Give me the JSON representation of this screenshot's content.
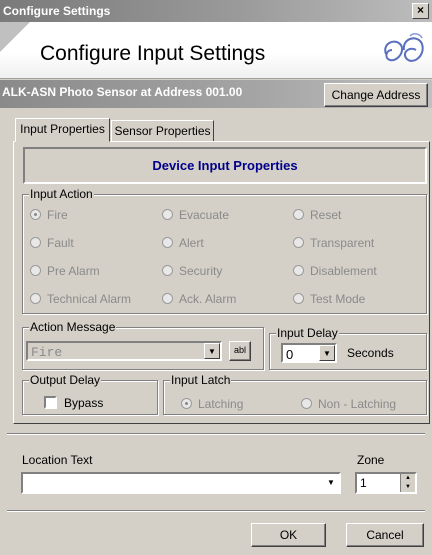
{
  "window": {
    "title": "Configure Settings",
    "close_glyph": "×"
  },
  "banner": {
    "heading": "Configure Input Settings",
    "logo_icon": "swirl-logo-icon"
  },
  "device": {
    "label": "ALK-ASN Photo Sensor at Address 001.00",
    "change_address_label": "Change Address"
  },
  "tabs": [
    {
      "label": "Input Properties",
      "selected": true
    },
    {
      "label": "Sensor Properties",
      "selected": false
    }
  ],
  "panel_title": "Device Input Properties",
  "input_action": {
    "legend": "Input Action",
    "options": [
      {
        "label": "Fire",
        "selected": true
      },
      {
        "label": "Evacuate",
        "selected": false
      },
      {
        "label": "Reset",
        "selected": false
      },
      {
        "label": "Fault",
        "selected": false
      },
      {
        "label": "Alert",
        "selected": false
      },
      {
        "label": "Transparent",
        "selected": false
      },
      {
        "label": "Pre Alarm",
        "selected": false
      },
      {
        "label": "Security",
        "selected": false
      },
      {
        "label": "Disablement",
        "selected": false
      },
      {
        "label": "Technical Alarm",
        "selected": false
      },
      {
        "label": "Ack. Alarm",
        "selected": false
      },
      {
        "label": "Test Mode",
        "selected": false
      }
    ]
  },
  "action_message": {
    "legend": "Action Message",
    "value": "Fire",
    "abl_label": "abl"
  },
  "input_delay": {
    "legend": "Input Delay",
    "value": "0",
    "unit": "Seconds"
  },
  "output_delay": {
    "legend": "Output Delay",
    "bypass_label": "Bypass",
    "bypass_checked": false
  },
  "input_latch": {
    "legend": "Input Latch",
    "options": [
      {
        "label": "Latching",
        "selected": true
      },
      {
        "label": "Non - Latching",
        "selected": false
      }
    ]
  },
  "location": {
    "label": "Location Text",
    "value": ""
  },
  "zone": {
    "label": "Zone",
    "value": "1"
  },
  "buttons": {
    "ok": "OK",
    "cancel": "Cancel"
  },
  "colors": {
    "panel_title": "#00008b",
    "dialog_bg": "#d4d0c8",
    "disabled_text": "#8a8a8a"
  }
}
